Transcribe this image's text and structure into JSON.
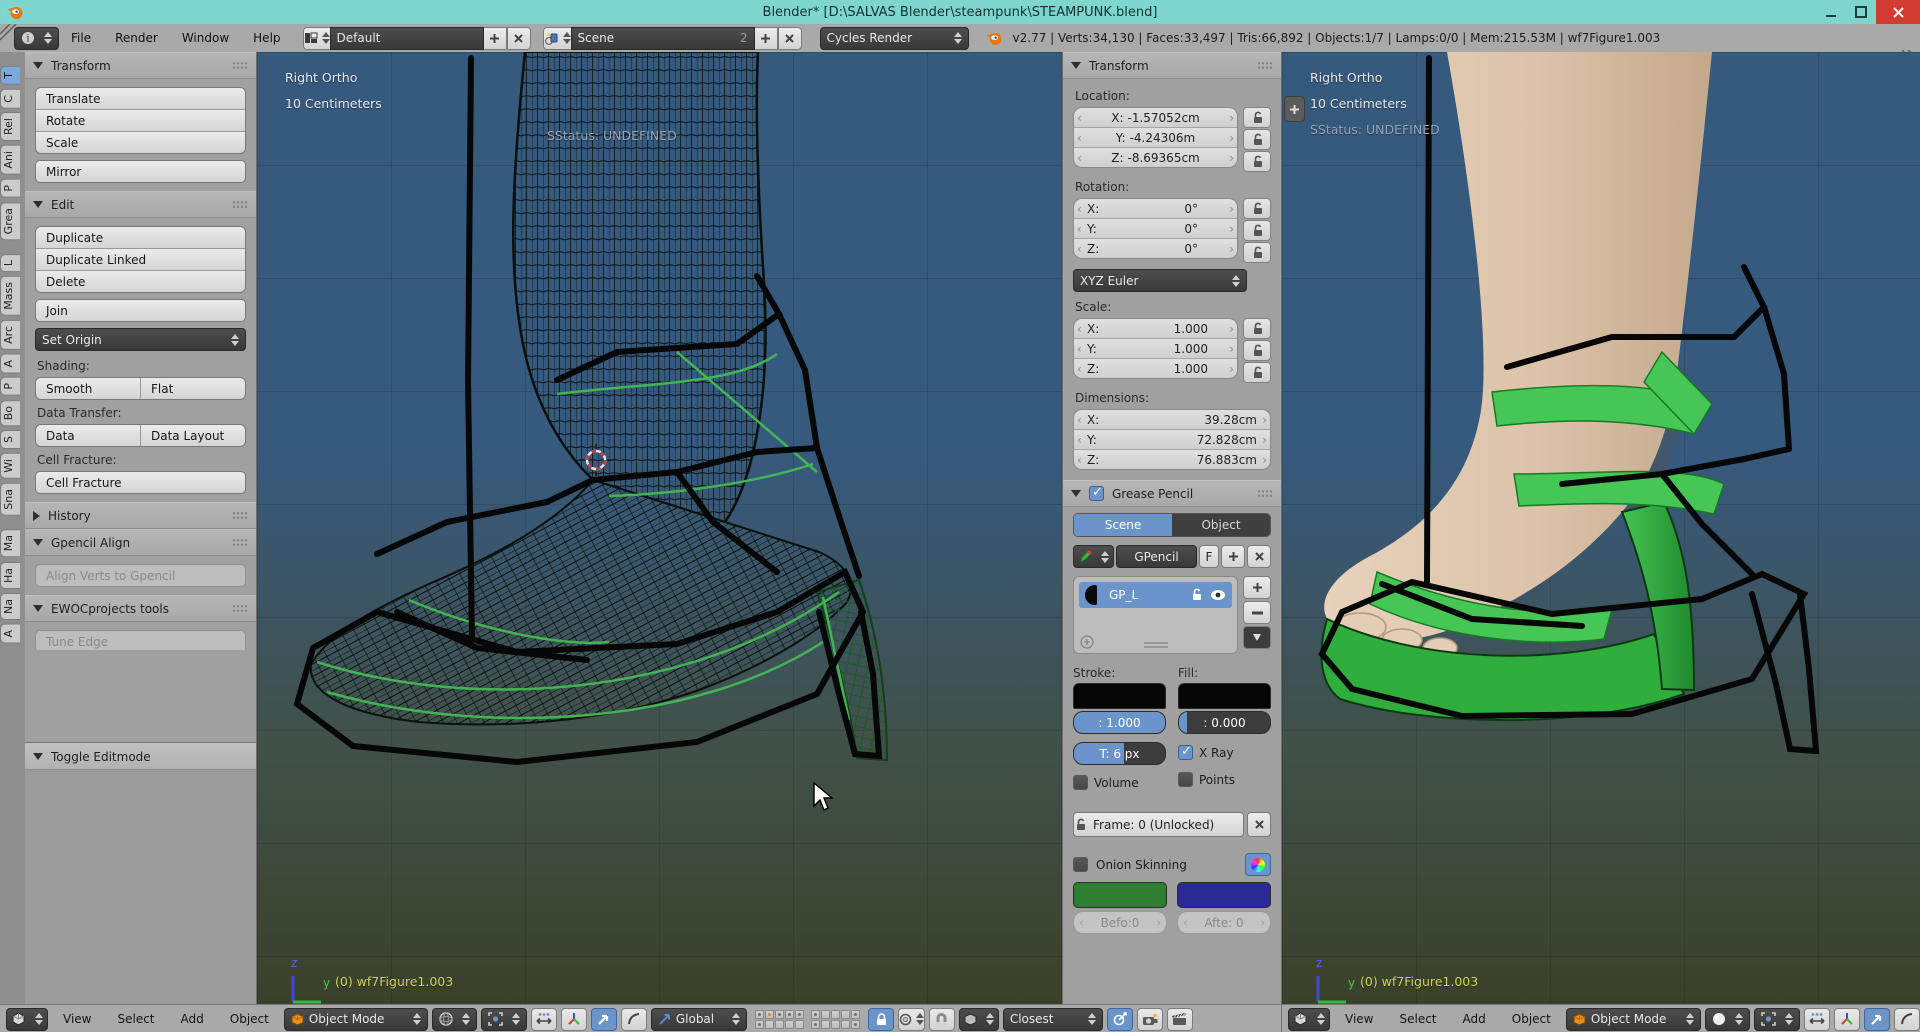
{
  "window": {
    "title": "Blender* [D:\\SALVAS Blender\\steampunk\\STEAMPUNK.blend]"
  },
  "topbar": {
    "menus": [
      "File",
      "Render",
      "Window",
      "Help"
    ],
    "layout": "Default",
    "scene": "Scene",
    "scene_users": "2",
    "engine": "Cycles Render",
    "stats": "v2.77 | Verts:34,130 | Faces:33,497 | Tris:66,892 | Objects:1/7 | Lamps:0/0 | Mem:215.53M | wf7Figure1.003"
  },
  "tool_tabs": [
    "T",
    "C",
    "Rel",
    "Ani",
    "P",
    "Grea",
    "L",
    "Mass",
    "Arc",
    "A",
    "P",
    "Bo",
    "S",
    "Wi",
    "Sna",
    "Ma",
    "Ha",
    "Na",
    "A"
  ],
  "tool_shelf": {
    "transform_title": "Transform",
    "translate": "Translate",
    "rotate": "Rotate",
    "scale": "Scale",
    "mirror": "Mirror",
    "edit_title": "Edit",
    "duplicate": "Duplicate",
    "duplicate_linked": "Duplicate Linked",
    "delete": "Delete",
    "join": "Join",
    "set_origin": "Set Origin",
    "shading_label": "Shading:",
    "smooth": "Smooth",
    "flat": "Flat",
    "data_transfer_label": "Data Transfer:",
    "data": "Data",
    "data_layout": "Data Layout",
    "cell_fracture_label": "Cell Fracture:",
    "cell_fracture": "Cell Fracture",
    "history_title": "History",
    "gpencil_align_title": "Gpencil Align",
    "align_verts": "Align Verts to Gpencil",
    "ewoc_title": "EWOCprojects tools",
    "tune_edge": "Tune Edge",
    "operator_title": "Toggle Editmode"
  },
  "viewport": {
    "view_label": "Right Ortho",
    "scale_label": "10 Centimeters",
    "sstatus": "SStatus: UNDEFINED",
    "object_label": "(0) wf7Figure1.003",
    "axis_z": "z",
    "axis_y": "y"
  },
  "npanel": {
    "transform_title": "Transform",
    "location_label": "Location:",
    "loc_x_label": "X:",
    "loc_x": "-1.57052cm",
    "loc_y_label": "Y:",
    "loc_y": "-4.24306m",
    "loc_z_label": "Z:",
    "loc_z": "-8.69365cm",
    "rotation_label": "Rotation:",
    "rot_x_label": "X:",
    "rot_x": "0°",
    "rot_y_label": "Y:",
    "rot_y": "0°",
    "rot_z_label": "Z:",
    "rot_z": "0°",
    "euler": "XYZ Euler",
    "scale_label": "Scale:",
    "scale_x_label": "X:",
    "scale_x": "1.000",
    "scale_y_label": "Y:",
    "scale_y": "1.000",
    "scale_z_label": "Z:",
    "scale_z": "1.000",
    "dimensions_label": "Dimensions:",
    "dim_x_label": "X:",
    "dim_x": "39.28cm",
    "dim_y_label": "Y:",
    "dim_y": "72.828cm",
    "dim_z_label": "Z:",
    "dim_z": "76.883cm"
  },
  "gpencil": {
    "title": "Grease Pencil",
    "tab_scene": "Scene",
    "tab_object": "Object",
    "datablock": "GPencil",
    "fake_user": "F",
    "layer_name": "GP_L",
    "stroke_label": "Stroke:",
    "fill_label": "Fill:",
    "stroke_alpha": ": 1.000",
    "fill_alpha": ": 0.000",
    "thickness": "T: 6 px",
    "xray": "X Ray",
    "volume": "Volume",
    "points": "Points",
    "frame": "Frame: 0 (Unlocked)",
    "onion": "Onion Skinning",
    "before": "Befo:0",
    "after": "Afte: 0"
  },
  "footer": {
    "menus": [
      "View",
      "Select",
      "Add",
      "Object"
    ],
    "mode": "Object Mode",
    "orientation": "Global",
    "snap_target": "Closest"
  },
  "colors": {
    "accent_blue": "#6b94ca",
    "titlebar_teal": "#7ed6cd",
    "viewport_top": "#36597e",
    "viewport_bottom": "#3a412a",
    "object_label_yellow": "#ccd84c",
    "onion_before": "#2f7d31",
    "onion_after": "#2a2a96",
    "stroke_color": "#000000",
    "fill_color": "#000000"
  }
}
